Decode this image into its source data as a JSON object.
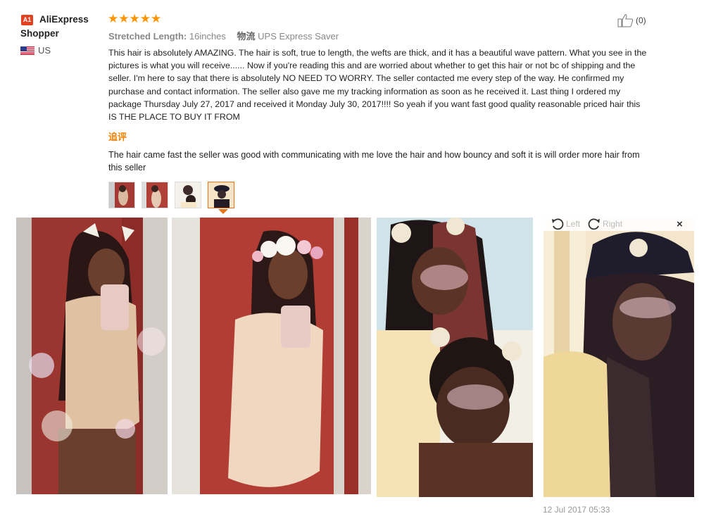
{
  "reviewer": {
    "badge": "A1",
    "name": "AliExpress Shopper",
    "country": "US"
  },
  "review": {
    "rating": 5,
    "stars": "★★★★★",
    "length_label": "Stretched Length:",
    "length_value": "16inches",
    "shipping_label": "物流",
    "shipping_value": "UPS Express Saver",
    "text": "This hair is absolutely AMAZING. The hair is soft, true to length, the wefts are thick, and it has a beautiful wave pattern. What you see in the pictures is what you will receive...... Now if you're reading this and are worried about whether to get this hair or not bc of shipping and the seller. I'm here to say that there is absolutely NO NEED TO WORRY. The seller contacted me every step of the way. He confirmed my purchase and contact information. The seller also gave me my tracking information as soon as he received it. Last thing I ordered my package Thursday July 27, 2017 and received it Monday July 30, 2017!!!! So yeah if you want fast good quality reasonable priced hair this IS THE PLACE TO BUY IT FROM",
    "helpful_count": "(0)"
  },
  "followup": {
    "label": "追评",
    "text": "The hair came fast the seller was good with communicating with me love the hair and how bouncy and soft it is will order more hair from this seller"
  },
  "viewer": {
    "left_label": "Left",
    "right_label": "Right",
    "close": "×",
    "selected_index": 3
  },
  "date": "12 Jul 2017 05:33",
  "colors": {
    "accent": "#ff9400",
    "followup": "#f08200",
    "badge": "#e3411f"
  }
}
